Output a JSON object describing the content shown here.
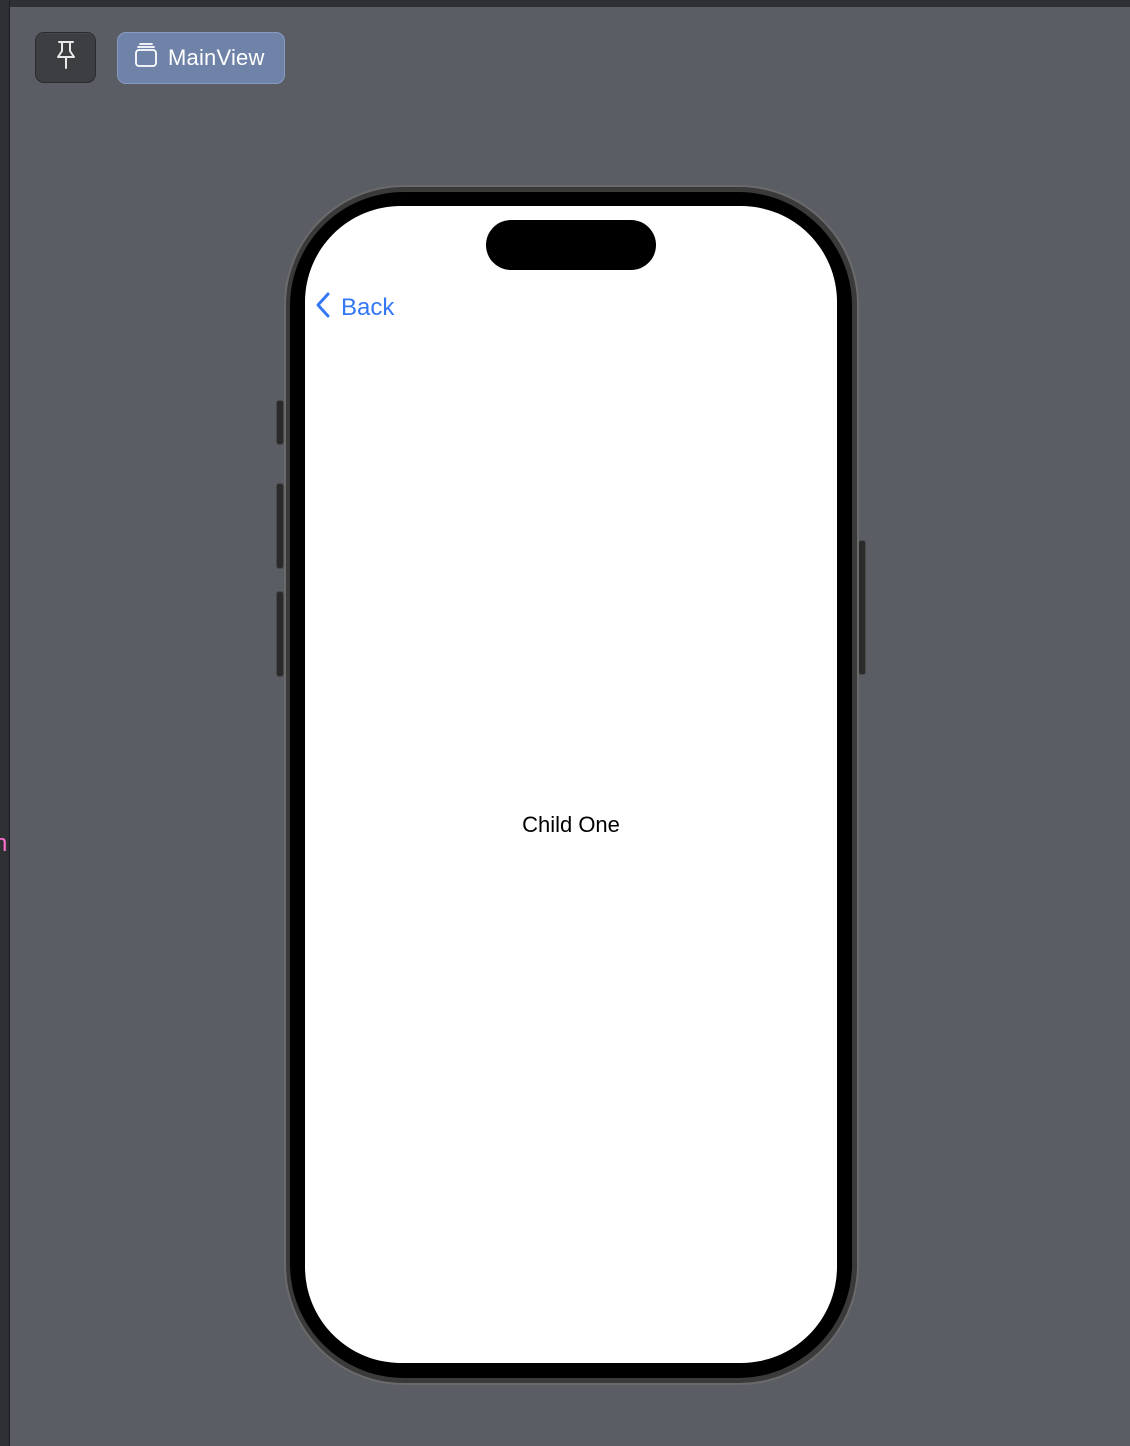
{
  "toolbar": {
    "pin_icon": "pin-icon",
    "view_button_label": "MainView",
    "view_icon": "stack-icon"
  },
  "side_glyph": "n",
  "phone": {
    "nav": {
      "back_label": "Back",
      "back_icon": "chevron-left-icon"
    },
    "content": {
      "text": "Child One"
    }
  },
  "colors": {
    "canvas_background": "#5a5d64",
    "view_button_background": "#6f83a9",
    "link_blue": "#3478f6",
    "side_glyph": "#ff6fcf"
  }
}
